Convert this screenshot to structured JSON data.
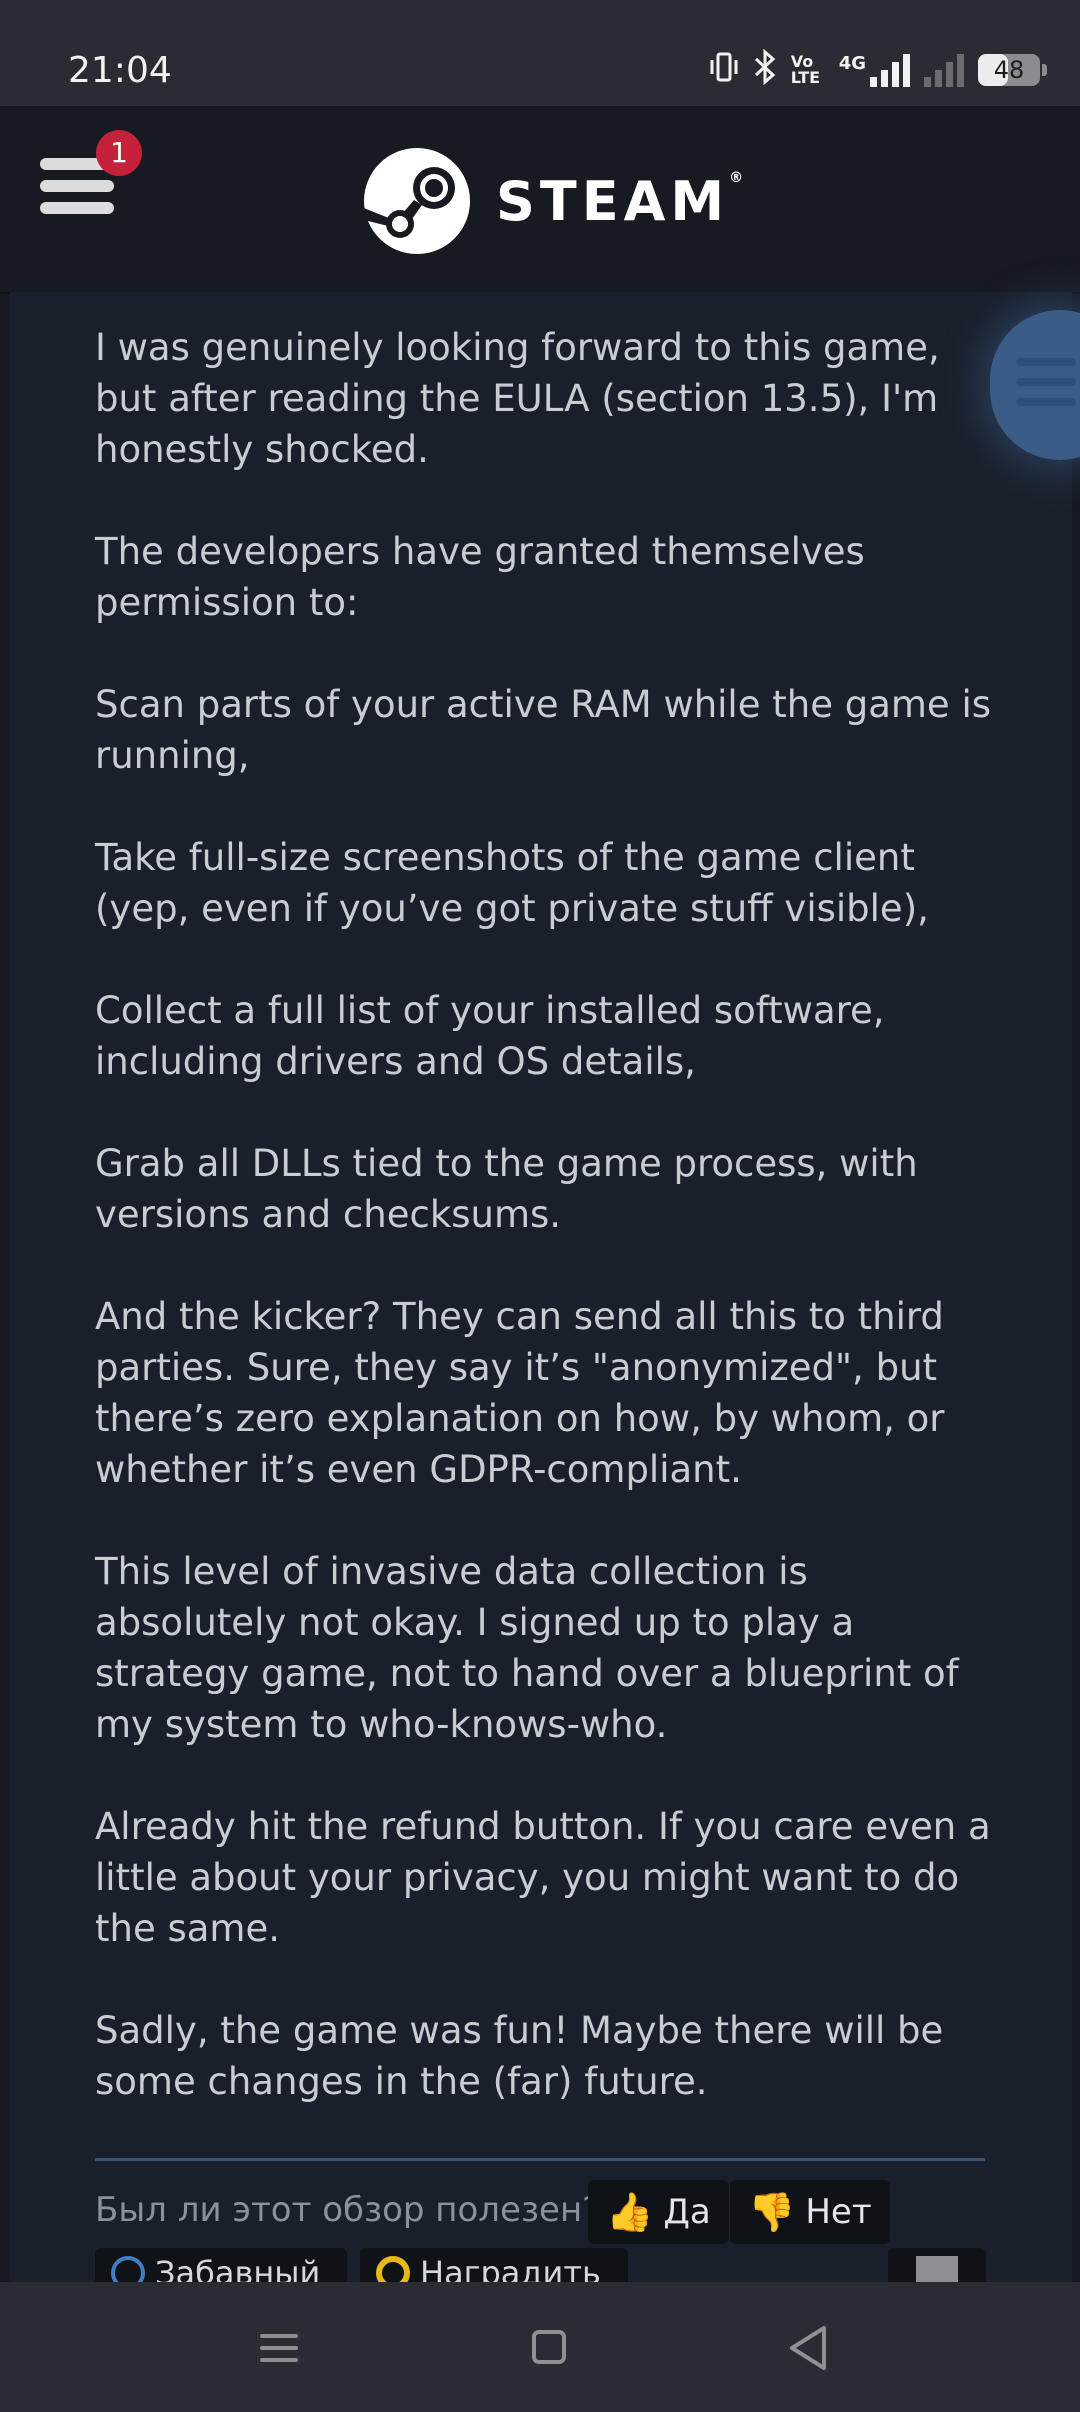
{
  "status_bar": {
    "time": "21:04",
    "icons": [
      "vibrate-icon",
      "bluetooth-icon",
      "volte-icon",
      "4g-signal-icon",
      "no-signal-icon"
    ],
    "network_label": "4G",
    "volte_label": "Vo LTE",
    "battery_level": "48"
  },
  "header": {
    "notification_count": "1",
    "brand": "STEAM",
    "trademark": "®"
  },
  "review": {
    "paragraphs": [
      "I was genuinely looking forward to this game, but after reading the EULA (section 13.5), I'm honestly shocked.",
      "The developers have granted themselves permission to:",
      "Scan parts of your active RAM while the game is running,",
      "Take full-size screenshots of the game client (yep, even if you’ve got private stuff visible),",
      "Collect a full list of your installed software, including drivers and OS details,",
      "Grab all DLLs tied to the game process, with versions and checksums.",
      "And the kicker? They can send all this to third parties. Sure, they say it’s \"anonymized\", but there’s zero explanation on how, by whom, or whether it’s even GDPR-compliant.",
      "This level of invasive data collection is absolutely not okay. I signed up to play a strategy game, not to hand over a blueprint of my system to who-knows-who.",
      "Already hit the refund button. If you care even a little about your privacy, you might want to do the same.",
      "Sadly, the game was fun! Maybe there will be some changes in the (far) future."
    ]
  },
  "helpful": {
    "question": "Был ли этот обзор полезен?",
    "yes_label": "Да",
    "no_label": "Нет",
    "funny_label": "Забавный",
    "award_label": "Наградить"
  },
  "colors": {
    "background": "#171a21",
    "content": "#1a202b",
    "notification": "#c6213a",
    "accent": "#3a5c86"
  }
}
